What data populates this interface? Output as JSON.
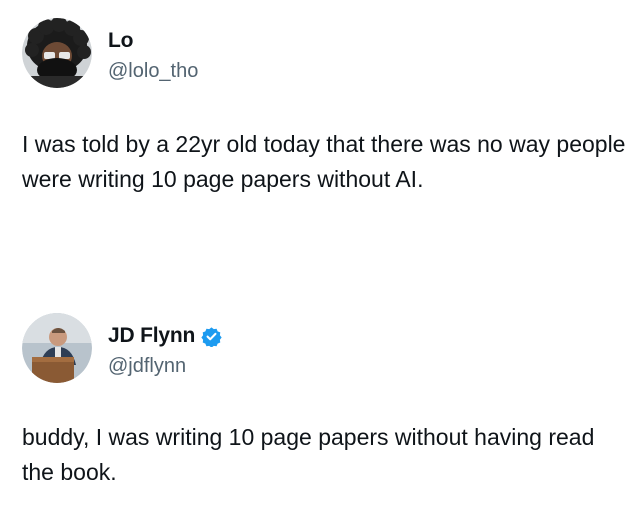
{
  "tweets": [
    {
      "display_name": "Lo",
      "handle": "@lolo_tho",
      "verified": false,
      "text": "I was told by a 22yr old today that there was no way people were writing 10 page papers without AI."
    },
    {
      "display_name": "JD Flynn",
      "handle": "@jdflynn",
      "verified": true,
      "text": "buddy, I was writing 10 page papers without having read the book."
    }
  ],
  "colors": {
    "text": "#0f1419",
    "secondary_text": "#536471",
    "verified_badge": "#1d9bf0",
    "background": "#ffffff"
  },
  "icons": {
    "verified": "verified-badge-icon"
  }
}
